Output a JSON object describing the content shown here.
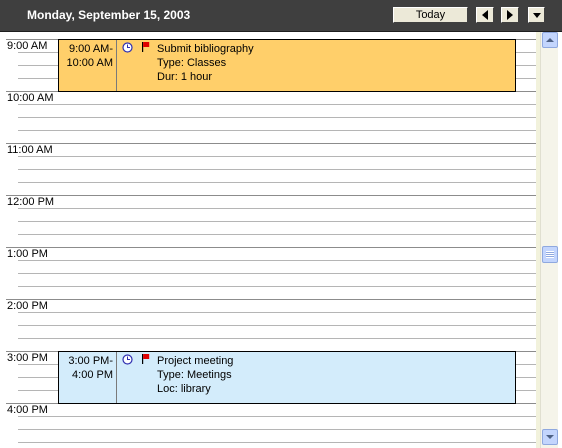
{
  "header": {
    "date_title": "Monday, September 15, 2003",
    "today_label": "Today"
  },
  "times": [
    "9:00 AM",
    "10:00 AM",
    "11:00 AM",
    "12:00 PM",
    "1:00 PM",
    "2:00 PM",
    "3:00 PM",
    "4:00 PM"
  ],
  "appointments": [
    {
      "start": "9:00 AM-",
      "end": "10:00 AM",
      "subject": "Submit bibliography",
      "line2": "Type: Classes",
      "line3": "Dur: 1 hour",
      "color": "#ffcf6a"
    },
    {
      "start": "3:00 PM-",
      "end": "4:00 PM",
      "subject": "Project meeting",
      "line2": "Type: Meetings",
      "line3": "Loc: library",
      "color": "#d3ecfb"
    }
  ],
  "icons": {
    "reminder": "clock-icon",
    "flag": "flag-icon",
    "prev": "arrow-left-icon",
    "next": "arrow-right-icon",
    "menu": "chevron-down-icon"
  }
}
